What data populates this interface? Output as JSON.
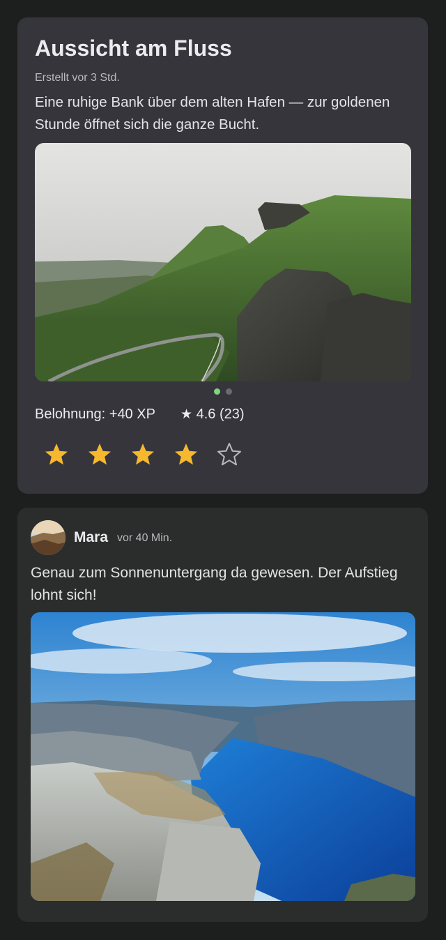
{
  "post": {
    "title": "Aussicht am Fluss",
    "meta": "Erstellt vor 3 Std.",
    "description": "Eine ruhige Bank über dem alten Hafen — zur goldenen Stunde öffnet sich die ganze Bucht.",
    "reward": "Belohnung: +40 XP",
    "rating_icon": "★",
    "rating_text": "4.6 (23)",
    "carousel": {
      "total": 2,
      "active": 1
    },
    "user_rating": {
      "filled": 4,
      "max": 5,
      "filled_color": "#f5b82e",
      "empty_color": "#b9b8bf"
    }
  },
  "comment": {
    "author": "Mara",
    "time": "vor 40 Min.",
    "text": "Genau zum Sonnenuntergang da gewesen. Der Aufstieg lohnt sich!"
  }
}
